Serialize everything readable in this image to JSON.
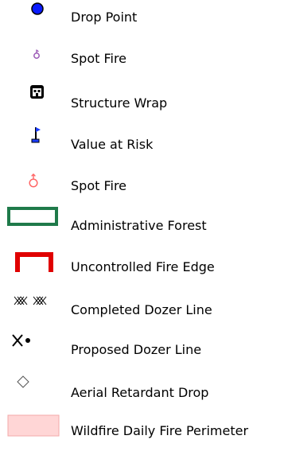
{
  "legend": {
    "items": [
      {
        "label": "Drop Point",
        "icon": "drop-point-icon",
        "color": "#0000ff"
      },
      {
        "label": "Spot Fire",
        "icon": "spot-fire-purple-icon",
        "color": "#9b59b6"
      },
      {
        "label": "Structure Wrap",
        "icon": "structure-wrap-icon",
        "color": "#000000"
      },
      {
        "label": "Value at Risk",
        "icon": "value-at-risk-flag-icon",
        "color": "#1a3cff"
      },
      {
        "label": "Spot Fire",
        "icon": "spot-fire-red-icon",
        "color": "#ff6666"
      },
      {
        "label": "Administrative Forest",
        "icon": "administrative-forest-icon",
        "color": "#1f7a4a"
      },
      {
        "label": "Uncontrolled Fire Edge",
        "icon": "uncontrolled-fire-edge-icon",
        "color": "#e00000"
      },
      {
        "label": "Completed Dozer Line",
        "icon": "completed-dozer-line-icon",
        "color": "#000000"
      },
      {
        "label": "Proposed Dozer Line",
        "icon": "proposed-dozer-line-icon",
        "color": "#000000"
      },
      {
        "label": "Aerial Retardant Drop",
        "icon": "aerial-retardant-drop-icon",
        "color": "#555555"
      },
      {
        "label": "Wildfire Daily Fire Perimeter",
        "icon": "wildfire-daily-fire-perimeter-icon",
        "color": "#ffd6d6"
      }
    ]
  }
}
